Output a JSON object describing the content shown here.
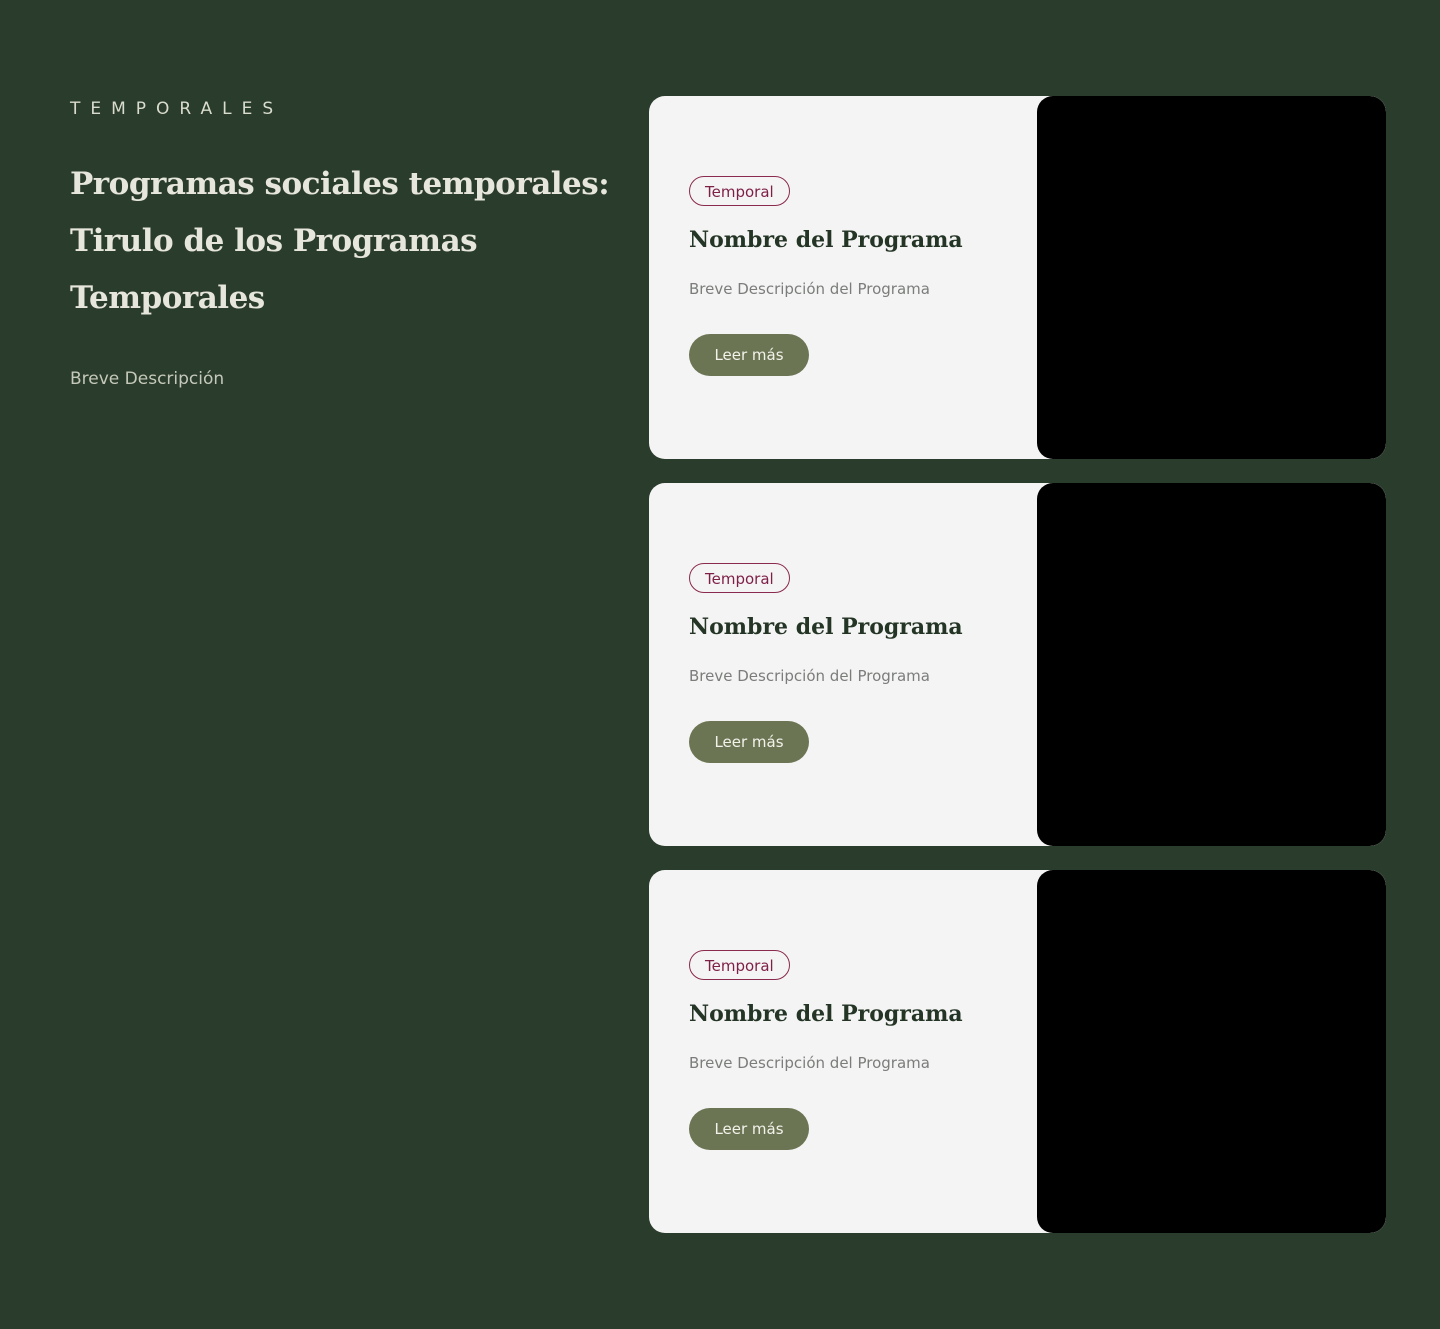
{
  "intro": {
    "eyebrow": "TEMPORALES",
    "headline": "Programas sociales temporales: Tirulo de los Programas Temporales",
    "description": "Breve Descripción"
  },
  "cards": [
    {
      "tag": "Temporal",
      "title": "Nombre del Programa",
      "description": "Breve Descripción del Programa",
      "button_label": "Leer más"
    },
    {
      "tag": "Temporal",
      "title": "Nombre del Programa",
      "description": "Breve Descripción del Programa",
      "button_label": "Leer más"
    },
    {
      "tag": "Temporal",
      "title": "Nombre del Programa",
      "description": "Breve Descripción del Programa",
      "button_label": "Leer más"
    }
  ],
  "colors": {
    "background": "#2a3c2b",
    "card_background": "#f4f4f4",
    "tag_accent": "#7e1f46",
    "button": "#6b7554",
    "media_placeholder": "#000000"
  }
}
